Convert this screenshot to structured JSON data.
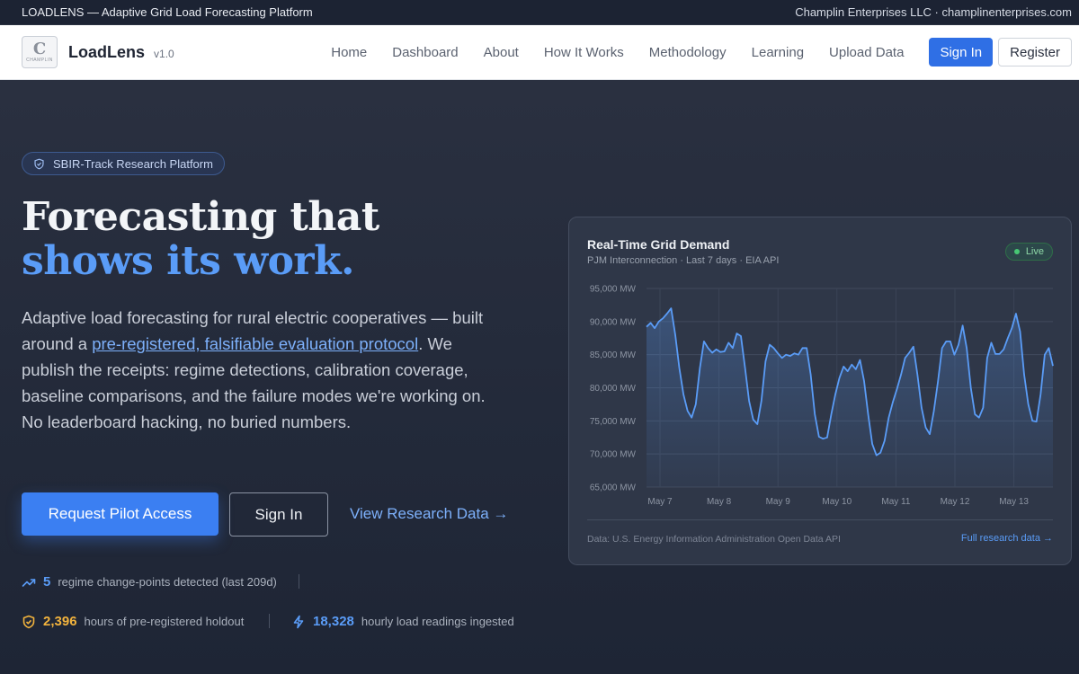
{
  "topbar": {
    "left": "LOADLENS — Adaptive Grid Load Forecasting Platform",
    "right": "Champlin Enterprises LLC · champlinenterprises.com"
  },
  "nav": {
    "logo_glyph": "C",
    "logo_text": "CHAMPLIN",
    "brand": "LoadLens",
    "version": "v1.0",
    "links": [
      "Home",
      "Dashboard",
      "About",
      "How It Works",
      "Methodology",
      "Learning",
      "Upload Data"
    ],
    "signin": "Sign In",
    "register": "Register"
  },
  "hero": {
    "badge": "SBIR-Track Research Platform",
    "headline_1": "Forecasting that",
    "headline_2": "shows its work.",
    "lede_pre": "Adaptive load forecasting for rural electric cooperatives — built around a ",
    "lede_link": "pre-registered, falsifiable evaluation protocol",
    "lede_post": ". We publish the receipts: regime detections, calibration coverage, baseline comparisons, and the failure modes we're working on. No leaderboard hacking, no buried numbers.",
    "cta_primary": "Request Pilot Access",
    "cta_secondary": "Sign In",
    "cta_link": "View Research Data →"
  },
  "stats": [
    {
      "icon": "trend-up-icon",
      "value": "5",
      "label": "regime change-points detected (last 209d)",
      "color": "#5a9cf7"
    },
    {
      "icon": "shield-check-icon",
      "value": "2,396",
      "label": "hours of pre-registered holdout",
      "color": "#f2b33d"
    },
    {
      "icon": "bolt-icon",
      "value": "18,328",
      "label": "hourly load readings ingested",
      "color": "#5a9cf7"
    }
  ],
  "card": {
    "title": "Real-Time Grid Demand",
    "subtitle": "PJM Interconnection · Last 7 days · EIA API",
    "live": "Live",
    "footer": "Data: U.S. Energy Information Administration Open Data API",
    "footer_link": "Full research data →"
  },
  "colors": {
    "accent": "#3b7ff2",
    "line": "#5a9cf7",
    "live": "#47c774",
    "stat_gold": "#f2b33d"
  },
  "chart_data": {
    "type": "area",
    "y_unit": "MW",
    "ylim": [
      65000,
      95000
    ],
    "yticks": [
      95000,
      90000,
      85000,
      80000,
      75000,
      70000,
      65000
    ],
    "ytick_labels": [
      "95,000 MW",
      "90,000 MW",
      "85,000 MW",
      "80,000 MW",
      "75,000 MW",
      "70,000 MW",
      "65,000 MW"
    ],
    "xtick_labels": [
      "May 7",
      "May 8",
      "May 9",
      "May 10",
      "May 11",
      "May 12",
      "May 13"
    ],
    "x_start_label": "May 7",
    "grid": true,
    "series": [
      {
        "values": [
          89200,
          89800,
          89000,
          90000,
          90500,
          91200,
          92000,
          88000,
          83000,
          79000,
          76500,
          75500,
          77500,
          83000,
          87000,
          86000,
          85300,
          85800,
          85400,
          85500,
          86800,
          86000,
          88200,
          87800,
          83000,
          78000,
          75200,
          74500,
          78000,
          84000,
          86500,
          86000,
          85200,
          84500,
          85000,
          84800,
          85200,
          85000,
          86000,
          86000,
          82000,
          76000,
          72600,
          72300,
          72500,
          76000,
          79000,
          81500,
          83200,
          82500,
          83500,
          82800,
          84200,
          81000,
          76000,
          71500,
          69800,
          70200,
          72000,
          75500,
          77800,
          79800,
          82000,
          84500,
          85300,
          86200,
          82000,
          77000,
          74000,
          73000,
          76500,
          81000,
          86000,
          87000,
          87000,
          85000,
          86500,
          89400,
          86000,
          80000,
          76000,
          75500,
          77000,
          84500,
          86800,
          85100,
          85100,
          85800,
          87500,
          89000,
          91200,
          88500,
          82000,
          77500,
          75000,
          74900,
          79000,
          85000,
          86000,
          83300
        ]
      }
    ]
  }
}
